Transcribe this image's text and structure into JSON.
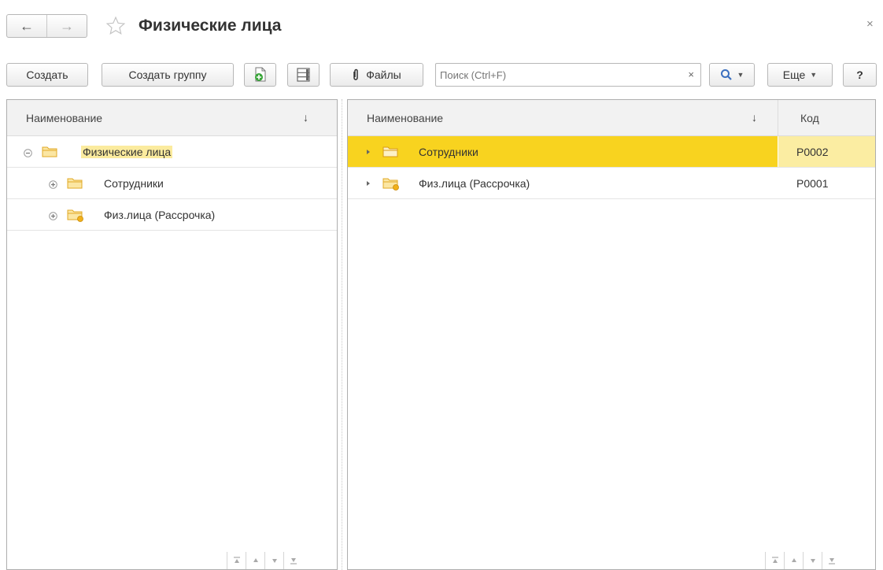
{
  "window": {
    "title": "Физические лица",
    "close_label": "×"
  },
  "toolbar": {
    "create_label": "Создать",
    "create_group_label": "Создать группу",
    "files_label": "Файлы",
    "search_placeholder": "Поиск (Ctrl+F)",
    "search_clear": "×",
    "more_label": "Еще",
    "help_label": "?"
  },
  "left_panel": {
    "column_header": "Наименование",
    "sort_indicator": "↓",
    "tree": [
      {
        "label": "Физические лица",
        "level": 0,
        "expanded": true,
        "icon": "folder-icon"
      },
      {
        "label": "Сотрудники",
        "level": 1,
        "expanded": false,
        "icon": "folder-icon"
      },
      {
        "label": "Физ.лица (Рассрочка)",
        "level": 1,
        "expanded": false,
        "icon": "folder-special-icon"
      }
    ]
  },
  "right_panel": {
    "column_name_header": "Наименование",
    "sort_indicator": "↓",
    "column_code_header": "Код",
    "rows": [
      {
        "name": "Сотрудники",
        "code": "Р0002",
        "selected": true,
        "icon": "folder-icon"
      },
      {
        "name": "Физ.лица (Рассрочка)",
        "code": "Р0001",
        "selected": false,
        "icon": "folder-special-icon"
      }
    ]
  },
  "colors": {
    "selection": "#f8d31f",
    "selection_light": "#fbeda2",
    "highlight": "#fbeb9e",
    "folder": "#f3c94c"
  }
}
